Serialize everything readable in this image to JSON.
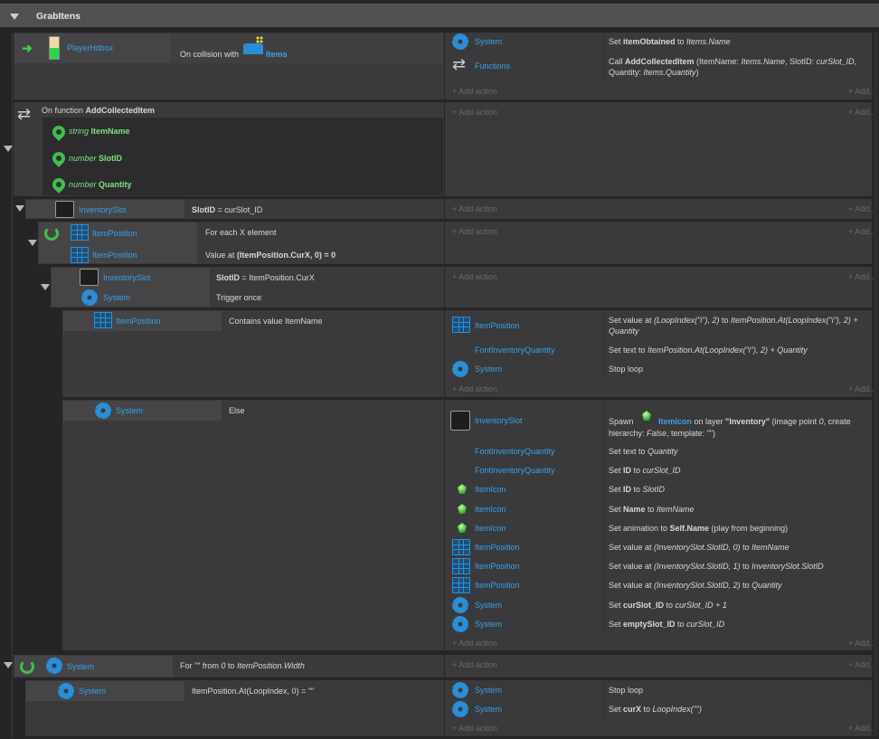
{
  "group": {
    "title": "GrabItens"
  },
  "add_action": "Add action",
  "add_more": "Add...",
  "e1": {
    "obj": "PlayerHitbox",
    "cond_prefix": "On collision with",
    "cond_obj": "Items",
    "actions": [
      {
        "obj": "System",
        "text_pre": "Set ",
        "bold": "itemObtained",
        "text_mid": " to ",
        "it": "Items.Name"
      },
      {
        "obj": "Functions",
        "text_pre": "Call ",
        "bold": "AddCollectedItem",
        "line1_rest": " (ItemName: ",
        "l1_it": "Items.Name",
        "l1_b": ", SlotID: ",
        "l1_it2": "curSlot_ID",
        "l1_c": ",",
        "line2_a": "Quantity: ",
        "line2_it": "Items.Quantity",
        "line2_b": ")"
      }
    ]
  },
  "fn": {
    "label": "On function",
    "name": "AddCollectedItem",
    "params": [
      {
        "type": "string",
        "name": "ItemName"
      },
      {
        "type": "number",
        "name": "SlotID"
      },
      {
        "type": "number",
        "name": "Quantity"
      }
    ]
  },
  "e2": {
    "obj": "InventorySlot",
    "cond_b": "SlotID",
    "cond_rest": " = curSlot_ID"
  },
  "e3": {
    "obj1": "ItemPosition",
    "cond1": "For each X element",
    "obj2": "ItemPosition",
    "cond2_pre": "Value at ",
    "cond2_b": "(ItemPosition.CurX",
    "cond2_c": ", 0) = 0"
  },
  "e4": {
    "obj1": "InventorySlot",
    "cond1_b": "SlotID",
    "cond1_rest": " = ItemPosition.CurX",
    "obj2": "System",
    "cond2": "Trigger once"
  },
  "e5": {
    "obj": "ItemPosition",
    "cond": "Contains value ItemName",
    "actions": [
      {
        "obj": "ItemPosition",
        "l1_a": "Set value at ",
        "l1_it": "(LoopIndex(\"i\"), 2)",
        "l1_b": " to ",
        "l1_it2": "ItemPosition.At(LoopIndex(\"i\"), 2) +",
        "l2_it": "Quantity"
      },
      {
        "obj": "FontInventoryQuantity",
        "a": "Set text to ",
        "it": "ItemPosition.At(LoopIndex(\"i\"), 2) + Quantity"
      },
      {
        "obj": "System",
        "a": "Stop loop"
      }
    ]
  },
  "e6": {
    "obj": "System",
    "cond": "Else",
    "spawn": {
      "obj": "InventorySlot",
      "a": "Spawn ",
      "b": "ItemIcon",
      "c": " on layer ",
      "d": "\"Inventory\"",
      "e": " (image point ",
      "f": "0",
      "g": ", create",
      "l2_a": "hierarchy: ",
      "l2_it": "False",
      "l2_b": ", template: \"\")"
    },
    "actions": [
      {
        "obj": "FontInventoryQuantity",
        "a": "Set text to ",
        "it": "Quantity",
        "icon": "none"
      },
      {
        "obj": "FontInventoryQuantity",
        "a": "Set ",
        "b": "ID",
        "c": " to ",
        "it": "curSlot_ID",
        "icon": "none"
      },
      {
        "obj": "ItemIcon",
        "a": "Set ",
        "b": "ID",
        "c": " to ",
        "it": "SlotID",
        "icon": "gem"
      },
      {
        "obj": "ItemIcon",
        "a": "Set ",
        "b": "Name",
        "c": " to ",
        "it": "ItemName",
        "icon": "gem"
      },
      {
        "obj": "ItemIcon",
        "a": "Set animation to ",
        "b": "Self.Name",
        "c": " (play from beginning)",
        "it": "",
        "icon": "gem"
      },
      {
        "obj": "ItemPosition",
        "a": "Set value at ",
        "it": "(InventorySlot.SlotID, 0)",
        "c": " to ",
        "it2": "ItemName",
        "icon": "grid"
      },
      {
        "obj": "ItemPosition",
        "a": "Set value at ",
        "it": "(InventorySlot.SlotID, 1)",
        "c": " to ",
        "it2": "InventorySlot.SlotID",
        "icon": "grid"
      },
      {
        "obj": "ItemPosition",
        "a": "Set value at ",
        "it": "(InventorySlot.SlotID, 2)",
        "c": " to ",
        "it2": "Quantity",
        "icon": "grid"
      },
      {
        "obj": "System",
        "a": "Set ",
        "b": "curSlot_ID",
        "c": " to ",
        "it": "curSlot_ID + 1",
        "icon": "gear"
      },
      {
        "obj": "System",
        "a": "Set ",
        "b": "emptySlot_ID",
        "c": " to ",
        "it": "curSlot_ID",
        "icon": "gear"
      }
    ]
  },
  "e7": {
    "obj": "System",
    "cond_a": "For \"\" from ",
    "cond_it": "0",
    "cond_b": " to ",
    "cond_it2": "ItemPosition.Width"
  },
  "e8": {
    "obj": "System",
    "cond": "ItemPosition.At(LoopIndex, 0)  = \"\"",
    "actions": [
      {
        "obj": "System",
        "a": "Stop loop"
      },
      {
        "obj": "System",
        "a": "Set ",
        "b": "curX",
        "c": " to ",
        "it": "LoopIndex(\"\")"
      }
    ]
  },
  "colors": {
    "link": "#3aa0e6",
    "green": "#3fbf4a",
    "block": "#3a3a3c",
    "background": "#252527"
  }
}
